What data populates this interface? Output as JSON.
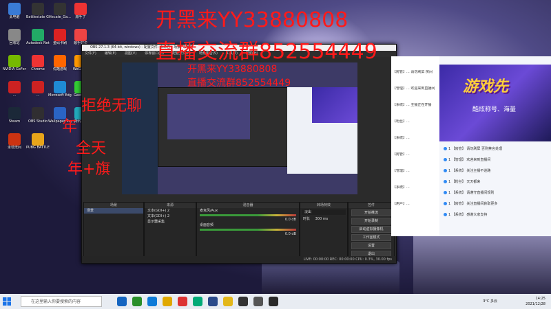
{
  "overlay": {
    "line1": "开黑来YY33880808",
    "line2": "直播交流群852554449",
    "line1_small": "开黑来YY33880808",
    "line2_small": "直播交流群852554449",
    "left1": "拒绝无聊",
    "left2": "年",
    "left3": "全天",
    "left4": "年+旗"
  },
  "desktop_icons": [
    {
      "label": "此电脑",
      "color": "#3a7bd5"
    },
    {
      "label": "Battlestate Games L...",
      "color": "#333"
    },
    {
      "label": "Hecate_Ga...",
      "color": "#333"
    },
    {
      "label": "顺手了",
      "color": "#e33"
    },
    {
      "label": "回收站",
      "color": "#888"
    },
    {
      "label": "Autodesk Netfab...",
      "color": "#2a6"
    },
    {
      "label": "金码卡刷",
      "color": "#d22"
    },
    {
      "label": "顺手好说",
      "color": "#e44"
    },
    {
      "label": "NVIDIA GeForce E...",
      "color": "#76b900"
    },
    {
      "label": "Chrome",
      "color": "#e33"
    },
    {
      "label": "优酷游戏",
      "color": "#f60"
    },
    {
      "label": "WeGame",
      "color": "#f90"
    },
    {
      "label": "...",
      "color": "#c22"
    },
    {
      "label": "...",
      "color": "#c22"
    },
    {
      "label": "Microsoft Edge",
      "color": "#1f8ad6"
    },
    {
      "label": "GeeGee",
      "color": "#3c3"
    },
    {
      "label": "Steam",
      "color": "#1b2838"
    },
    {
      "label": "OBS Studio",
      "color": "#302e31"
    },
    {
      "label": "Wallpaper Engine",
      "color": "#2a64c4"
    },
    {
      "label": "腾讯视频",
      "color": "#2ab"
    },
    {
      "label": "永劫无间",
      "color": "#c31"
    },
    {
      "label": "PUBG BATTLEGR...",
      "color": "#e8a51a"
    }
  ],
  "obs": {
    "title": "OBS 27.1.3 (64-bit, windows) - 配置文件: 未命名 - 场景: 未命名",
    "menu": [
      "文件(F)",
      "编辑(E)",
      "视图(V)",
      "停靠窗口(D)",
      "配置文件(P)",
      "场景集合(S)",
      "工具(T)",
      "帮助(H)"
    ],
    "scene_hdr": "场景",
    "source_hdr": "来源",
    "mixer_hdr": "混音器",
    "transition_hdr": "转场特效",
    "controls_hdr": "控件",
    "scenes": [
      "场景"
    ],
    "sources": [
      "文本(GDI+) 2",
      "文本(GDI+) 2",
      "显示器采集"
    ],
    "mixer": [
      {
        "name": "麦克风/Aux",
        "db": "0.0 dB"
      },
      {
        "name": "桌面音频",
        "db": "0.0 dB"
      }
    ],
    "transition": {
      "type": "淡出",
      "duration_label": "时长",
      "duration": "300 ms"
    },
    "controls": [
      "开始推流",
      "开始录制",
      "启动虚拟摄像机",
      "工作室模式",
      "设置",
      "退出"
    ],
    "status": "LIVE: 00:00:00   REC: 00:00:00   CPU: 0.3%, 30.00 fps"
  },
  "chat": {
    "top_labels": [
      "主播",
      "禁言",
      "回复"
    ],
    "messages": [
      "【房管】... 请勿刷屏 房间",
      "【管理】... 欢迎来到直播间",
      "【系统】... 主播正在开播",
      "【粉丝】...",
      "【系统】...",
      "【房管】...",
      "【管理】...",
      "【系统】...",
      "【用户】..."
    ]
  },
  "promo": {
    "title": "游戏先",
    "sub": "酷炫称号、海量",
    "msgs": [
      "1 【房管】 请勿刷屏 否则禁言处理",
      "1 【管理】 欢迎来到直播间",
      "1 【系统】 关注主播不迷路",
      "1 【粉丝】 天天都来",
      "1 【系统】 请遵守直播间规则",
      "1 【房管】 关注直播间获取更多",
      "1 【系统】 感谢大家支持"
    ]
  },
  "taskbar": {
    "search_placeholder": "在这里输入你要搜索的内容",
    "time": "14:25",
    "date": "2021/12/28",
    "temp": "3°C 多云",
    "apps": [
      "#1565c0",
      "#2a8f2a",
      "#0e7bd8",
      "#e0a800",
      "#d33",
      "#0a7",
      "#2a4a8a",
      "#e3b71a",
      "#333",
      "#555",
      "#2a2a2a"
    ]
  }
}
